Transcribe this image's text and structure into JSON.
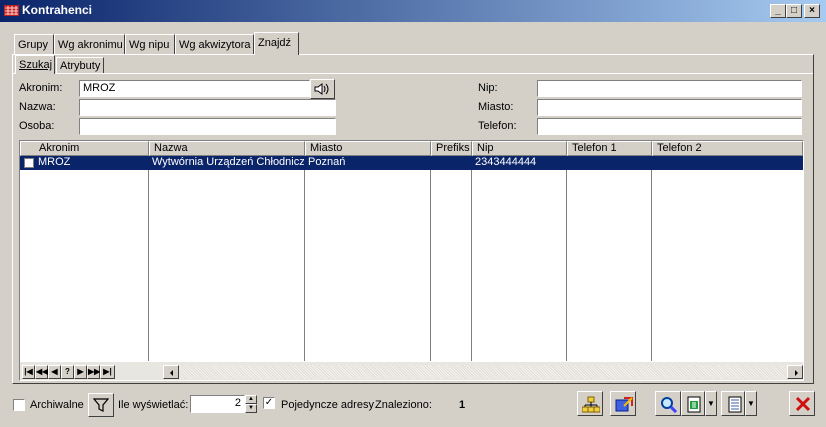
{
  "window": {
    "title": "Kontrahenci",
    "minimize": "_",
    "maximize": "□",
    "close": "×"
  },
  "tabs": [
    "Grupy",
    "Wg akronimu",
    "Wg nipu",
    "Wg akwizytora",
    "Znajdź"
  ],
  "subtabs": [
    "Szukaj",
    "Atrybuty"
  ],
  "form": {
    "akronim_label": "Akronim:",
    "akronim_value": "MROZ",
    "nazwa_label": "Nazwa:",
    "nazwa_value": "",
    "osoba_label": "Osoba:",
    "osoba_value": "",
    "nip_label": "Nip:",
    "nip_value": "",
    "miasto_label": "Miasto:",
    "miasto_value": "",
    "telefon_label": "Telefon:",
    "telefon_value": ""
  },
  "table": {
    "columns": [
      "Akronim",
      "Nazwa",
      "Miasto",
      "Prefiks",
      "Nip",
      "Telefon 1",
      "Telefon 2"
    ],
    "rows": [
      {
        "akronim": "MROZ",
        "nazwa": "Wytwórnia Urządzeń Chłodniczych",
        "miasto": "Poznań",
        "prefiks": "",
        "nip": "2343444444",
        "telefon1": "",
        "telefon2": ""
      }
    ]
  },
  "footer": {
    "archiwalne_label": "Archiwalne",
    "ile_label": "Ile wyświetlać:",
    "ile_value": "2",
    "pojedyncze_label": "Pojedyncze adresy",
    "znaleziono_label": "Znaleziono:",
    "znaleziono_value": "1"
  },
  "colors": {
    "selection": "#0a246a",
    "titlebar": "#0a246a",
    "face": "#d4d0c8",
    "close_red": "#d01010"
  }
}
